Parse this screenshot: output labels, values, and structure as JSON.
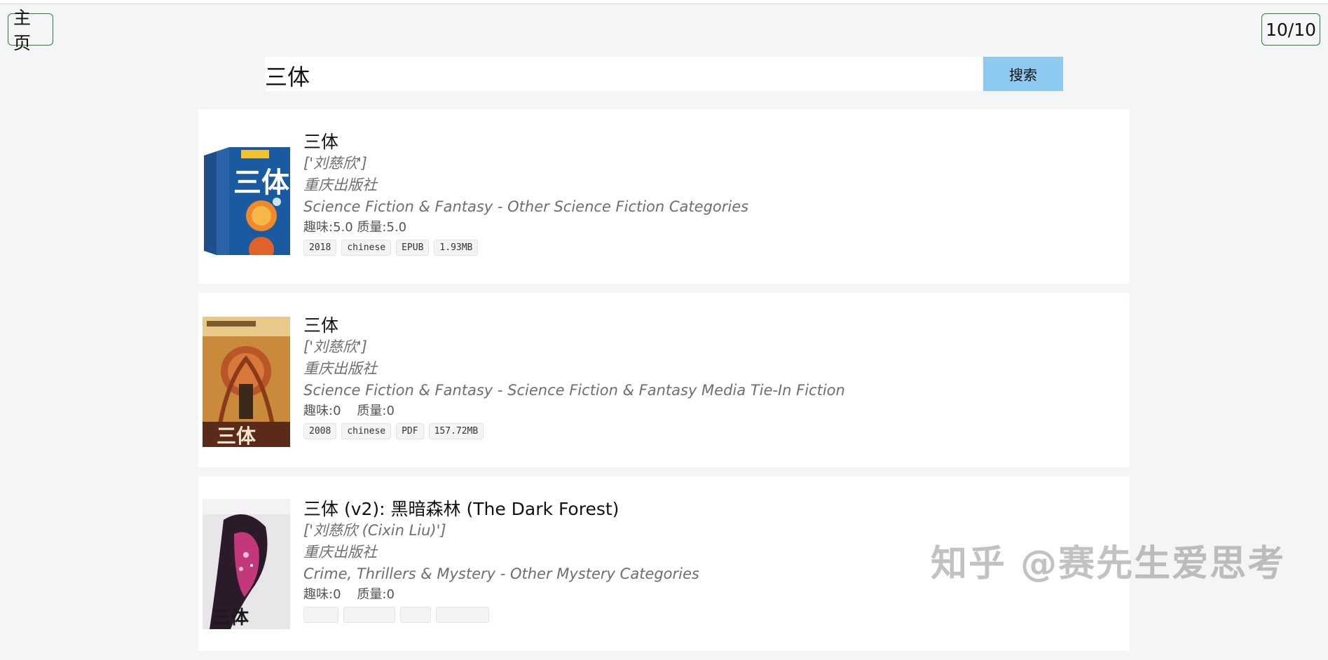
{
  "header": {
    "home_label": "主页",
    "page_indicator": "10/10"
  },
  "search": {
    "value": "三体",
    "button_label": "搜索"
  },
  "results": [
    {
      "title": "三体",
      "author": "['刘慈欣']",
      "publisher": "重庆出版社",
      "category": "Science Fiction & Fantasy - Other Science Fiction Categories",
      "scores": "趣味:5.0 质量:5.0",
      "tags": [
        "2018",
        "chinese",
        "EPUB",
        "1.93MB"
      ]
    },
    {
      "title": "三体",
      "author": "['刘慈欣']",
      "publisher": "重庆出版社",
      "category": "Science Fiction & Fantasy - Science Fiction & Fantasy Media Tie-In Fiction",
      "scores": "趣味:0    质量:0",
      "tags": [
        "2008",
        "chinese",
        "PDF",
        "157.72MB"
      ]
    },
    {
      "title": "三体 (v2): 黑暗森林 (The Dark Forest)",
      "author": "['刘慈欣 (Cixin Liu)']",
      "publisher": "重庆出版社",
      "category": "Crime, Thrillers & Mystery - Other Mystery Categories",
      "scores": "趣味:0    质量:0",
      "tags": [
        "",
        "",
        "",
        ""
      ]
    }
  ],
  "watermark": "知乎 @赛先生爱思考",
  "colors": {
    "search_button": "#8ec9ef",
    "button_border": "#2f7d3b",
    "background": "#f3f5f6"
  }
}
